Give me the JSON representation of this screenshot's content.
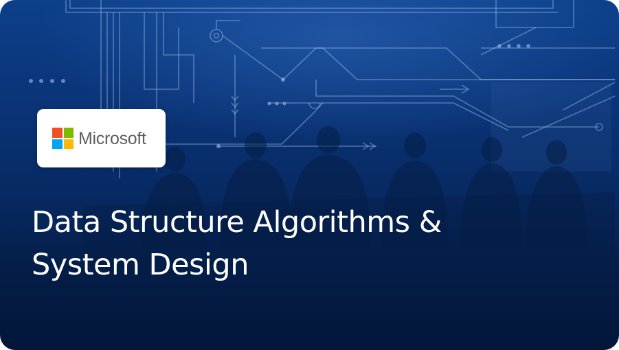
{
  "card": {
    "logo": {
      "brand_name": "Microsoft",
      "squares": [
        "#f25022",
        "#7fba00",
        "#00a4ef",
        "#ffb900"
      ]
    },
    "title_line1": "Data Structure Algorithms &",
    "title_line2": "System Design",
    "background": {
      "gradient_top": "#0d3f8a",
      "gradient_bottom": "#03163a",
      "circuit_color": "#9fc3f0"
    }
  }
}
